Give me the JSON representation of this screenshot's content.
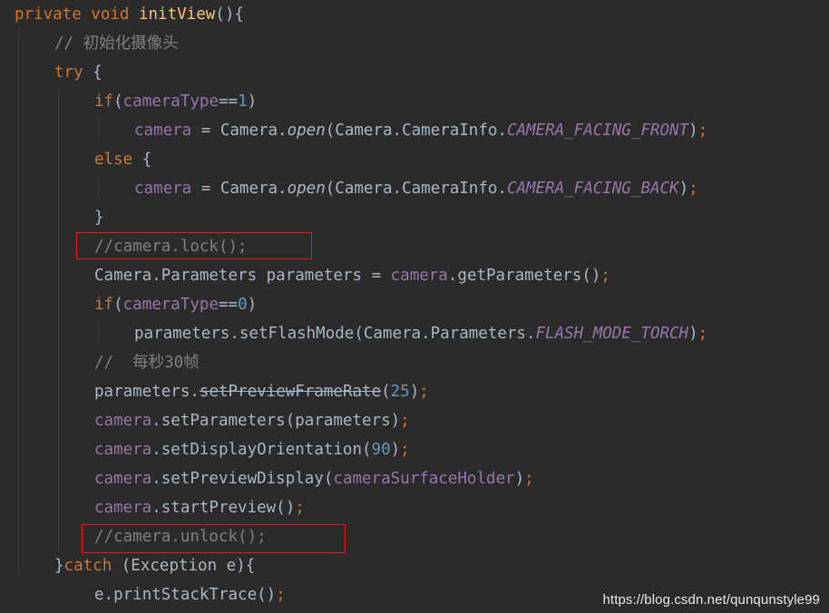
{
  "code_lines": [
    {
      "name": "line-method-signature",
      "tokens": [
        {
          "t": "kw",
          "v": "private "
        },
        {
          "t": "kw",
          "v": "void "
        },
        {
          "t": "fn",
          "v": "initView"
        },
        {
          "t": "plain",
          "v": "(){"
        }
      ]
    },
    {
      "name": "line-comment-init-camera",
      "tokens": [
        {
          "t": "comment",
          "v": "// 初始化摄像头"
        }
      ]
    },
    {
      "name": "line-try",
      "tokens": [
        {
          "t": "kw",
          "v": "try "
        },
        {
          "t": "plain",
          "v": "{"
        }
      ]
    },
    {
      "name": "line-if-front",
      "tokens": [
        {
          "t": "kw",
          "v": "if"
        },
        {
          "t": "plain",
          "v": "("
        },
        {
          "t": "field",
          "v": "cameraType"
        },
        {
          "t": "plain",
          "v": "=="
        },
        {
          "t": "num",
          "v": "1"
        },
        {
          "t": "plain",
          "v": ")"
        }
      ]
    },
    {
      "name": "line-open-front",
      "tokens": [
        {
          "t": "field",
          "v": "camera "
        },
        {
          "t": "plain",
          "v": "= Camera."
        },
        {
          "t": "method-static",
          "v": "open"
        },
        {
          "t": "plain",
          "v": "(Camera.CameraInfo."
        },
        {
          "t": "static",
          "v": "CAMERA_FACING_FRONT"
        },
        {
          "t": "plain",
          "v": ")"
        },
        {
          "t": "semi",
          "v": ";"
        }
      ]
    },
    {
      "name": "line-else",
      "tokens": [
        {
          "t": "kw",
          "v": "else "
        },
        {
          "t": "plain",
          "v": "{"
        }
      ]
    },
    {
      "name": "line-open-back",
      "tokens": [
        {
          "t": "field",
          "v": "camera "
        },
        {
          "t": "plain",
          "v": "= Camera."
        },
        {
          "t": "method-static",
          "v": "open"
        },
        {
          "t": "plain",
          "v": "(Camera.CameraInfo."
        },
        {
          "t": "static",
          "v": "CAMERA_FACING_BACK"
        },
        {
          "t": "plain",
          "v": ")"
        },
        {
          "t": "semi",
          "v": ";"
        }
      ]
    },
    {
      "name": "line-close-else",
      "tokens": [
        {
          "t": "plain",
          "v": "}"
        }
      ]
    },
    {
      "name": "line-comment-lock",
      "tokens": [
        {
          "t": "comment",
          "v": "//camera.lock();"
        }
      ]
    },
    {
      "name": "line-get-parameters",
      "tokens": [
        {
          "t": "plain",
          "v": "Camera.Parameters parameters = "
        },
        {
          "t": "field",
          "v": "camera"
        },
        {
          "t": "plain",
          "v": ".getParameters()"
        },
        {
          "t": "semi",
          "v": ";"
        }
      ]
    },
    {
      "name": "line-if-back",
      "tokens": [
        {
          "t": "kw",
          "v": "if"
        },
        {
          "t": "plain",
          "v": "("
        },
        {
          "t": "field",
          "v": "cameraType"
        },
        {
          "t": "plain",
          "v": "=="
        },
        {
          "t": "num",
          "v": "0"
        },
        {
          "t": "plain",
          "v": ")"
        }
      ]
    },
    {
      "name": "line-set-flash-mode",
      "tokens": [
        {
          "t": "plain",
          "v": "parameters.setFlashMode(Camera.Parameters."
        },
        {
          "t": "static",
          "v": "FLASH_MODE_TORCH"
        },
        {
          "t": "plain",
          "v": ")"
        },
        {
          "t": "semi",
          "v": ";"
        }
      ]
    },
    {
      "name": "line-comment-fps",
      "tokens": [
        {
          "t": "comment",
          "v": "//  每秒30帧"
        }
      ]
    },
    {
      "name": "line-set-frame-rate",
      "tokens": [
        {
          "t": "plain",
          "v": "parameters."
        },
        {
          "t": "strike",
          "v": "setPreviewFrameRate"
        },
        {
          "t": "plain",
          "v": "("
        },
        {
          "t": "num",
          "v": "25"
        },
        {
          "t": "plain",
          "v": ")"
        },
        {
          "t": "semi",
          "v": ";"
        }
      ]
    },
    {
      "name": "line-set-parameters",
      "tokens": [
        {
          "t": "field",
          "v": "camera"
        },
        {
          "t": "plain",
          "v": ".setParameters(parameters)"
        },
        {
          "t": "semi",
          "v": ";"
        }
      ]
    },
    {
      "name": "line-set-orientation",
      "tokens": [
        {
          "t": "field",
          "v": "camera"
        },
        {
          "t": "plain",
          "v": ".setDisplayOrientation("
        },
        {
          "t": "num",
          "v": "90"
        },
        {
          "t": "plain",
          "v": ")"
        },
        {
          "t": "semi",
          "v": ";"
        }
      ]
    },
    {
      "name": "line-set-preview-display",
      "tokens": [
        {
          "t": "field",
          "v": "camera"
        },
        {
          "t": "plain",
          "v": ".setPreviewDisplay("
        },
        {
          "t": "field",
          "v": "cameraSurfaceHolder"
        },
        {
          "t": "plain",
          "v": ")"
        },
        {
          "t": "semi",
          "v": ";"
        }
      ]
    },
    {
      "name": "line-start-preview",
      "tokens": [
        {
          "t": "field",
          "v": "camera"
        },
        {
          "t": "plain",
          "v": ".startPreview()"
        },
        {
          "t": "semi",
          "v": ";"
        }
      ]
    },
    {
      "name": "line-comment-unlock",
      "tokens": [
        {
          "t": "comment",
          "v": "//camera.unlock();"
        }
      ]
    },
    {
      "name": "line-catch",
      "tokens": [
        {
          "t": "plain",
          "v": "}"
        },
        {
          "t": "kw",
          "v": "catch "
        },
        {
          "t": "plain",
          "v": "(Exception e){"
        }
      ]
    },
    {
      "name": "line-print-stack-trace",
      "tokens": [
        {
          "t": "plain",
          "v": "e.printStackTrace()"
        },
        {
          "t": "semi",
          "v": ";"
        }
      ]
    }
  ],
  "watermark": "https://blog.csdn.net/qunqunstyle99",
  "colors": {
    "background": "#2b2b2b",
    "keyword": "#cc7832",
    "method_declaration": "#ffc66d",
    "default_text": "#a9b7c6",
    "comment": "#808080",
    "field": "#9876aa",
    "number": "#6897bb",
    "highlight_box": "#e02020"
  }
}
